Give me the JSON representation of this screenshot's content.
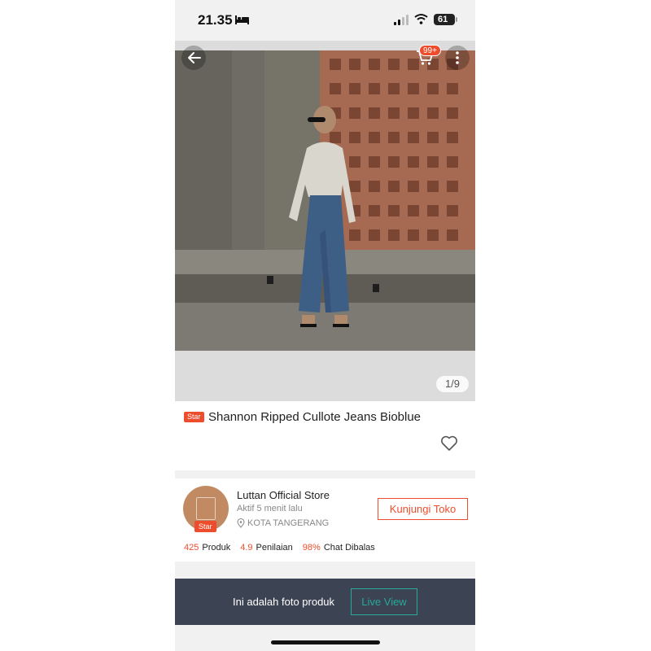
{
  "status_bar": {
    "time": "21.35",
    "battery": "61",
    "icons": [
      "bed-icon",
      "signal-icon",
      "wifi-icon",
      "battery-icon"
    ]
  },
  "gallery": {
    "cart_badge": "99+",
    "page_indicator": "1/9",
    "icons": [
      "back-arrow-icon",
      "cart-icon",
      "more-icon"
    ]
  },
  "product": {
    "badge": "Star",
    "title": "Shannon Ripped Cullote Jeans Bioblue",
    "icons": [
      "heart-icon"
    ]
  },
  "store": {
    "badge": "Star",
    "name": "Luttan Official Store",
    "active": "Aktif 5 menit lalu",
    "location": "KOTA TANGERANG",
    "visit_label": "Kunjungi Toko",
    "stats": [
      {
        "value": "425",
        "label": "Produk"
      },
      {
        "value": "4.9",
        "label": "Penilaian"
      },
      {
        "value": "98%",
        "label": "Chat Dibalas"
      }
    ]
  },
  "live_bar": {
    "text": "Ini adalah foto produk",
    "button": "Live View"
  },
  "colors": {
    "accent": "#ee4d2d",
    "live_button": "#26aa99",
    "live_bar": "#3c4353"
  }
}
